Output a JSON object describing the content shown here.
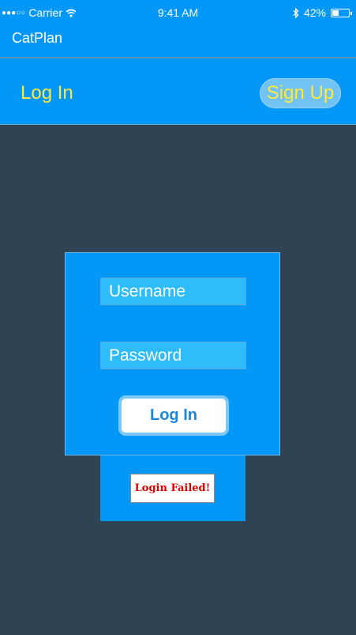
{
  "status_bar": {
    "signal": "●●●○○",
    "carrier": "Carrier",
    "wifi_icon": "wifi-icon",
    "time": "9:41 AM",
    "bluetooth_icon": "bluetooth-icon",
    "battery_percent": "42%",
    "battery_level": 0.42
  },
  "app_bar": {
    "title": "CatPlan"
  },
  "tabs": {
    "login_label": "Log In",
    "signup_label": "Sign Up"
  },
  "login_form": {
    "username_placeholder": "Username",
    "username_value": "",
    "password_placeholder": "Password",
    "password_value": "",
    "submit_label": "Log In"
  },
  "error": {
    "message": "Login Failed!"
  },
  "colors": {
    "primary": "#0397f8",
    "background": "#2e4452",
    "accent_text": "#ffe93b",
    "field_bg": "#2ebcfb",
    "error_text": "#e00000"
  }
}
